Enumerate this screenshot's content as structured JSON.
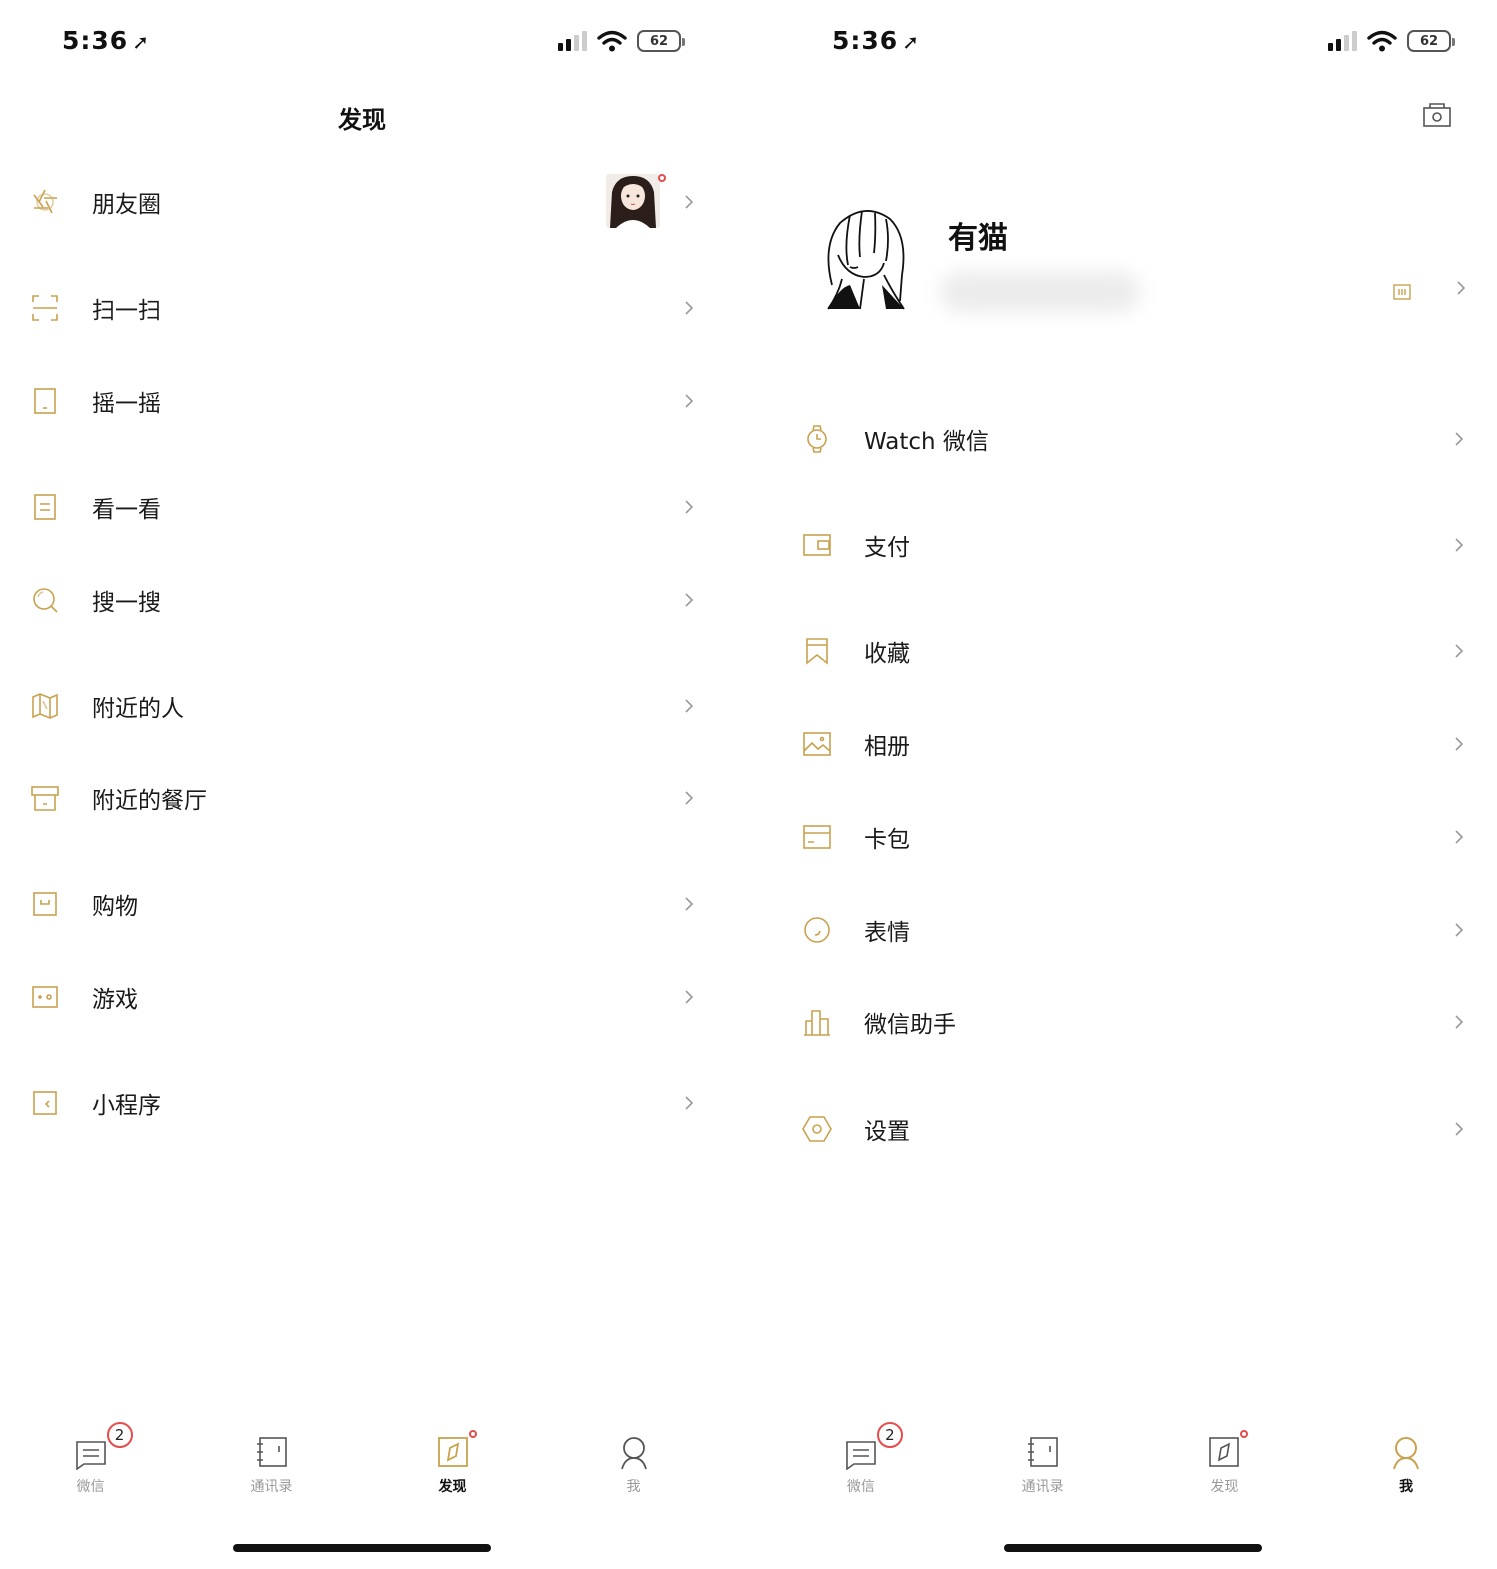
{
  "left": {
    "status": {
      "time": "5:36",
      "battery": "62"
    },
    "title": "发现",
    "items": [
      {
        "label": "朋友圈",
        "icon": "moments-icon"
      },
      {
        "label": "扫一扫",
        "icon": "scan-icon"
      },
      {
        "label": "摇一摇",
        "icon": "shake-icon"
      },
      {
        "label": "看一看",
        "icon": "top-stories-icon"
      },
      {
        "label": "搜一搜",
        "icon": "search-icon"
      },
      {
        "label": "附近的人",
        "icon": "map-icon"
      },
      {
        "label": "附近的餐厅",
        "icon": "restaurant-icon"
      },
      {
        "label": "购物",
        "icon": "shopping-icon"
      },
      {
        "label": "游戏",
        "icon": "game-icon"
      },
      {
        "label": "小程序",
        "icon": "mini-program-icon"
      }
    ],
    "tabs": [
      {
        "label": "微信",
        "badge": "2"
      },
      {
        "label": "通讯录"
      },
      {
        "label": "发现"
      },
      {
        "label": "我"
      }
    ]
  },
  "right": {
    "status": {
      "time": "5:36",
      "battery": "62"
    },
    "profile": {
      "name": "有猫"
    },
    "items": [
      {
        "label": "Watch 微信",
        "icon": "watch-icon"
      },
      {
        "label": "支付",
        "icon": "wallet-icon"
      },
      {
        "label": "收藏",
        "icon": "bookmark-icon"
      },
      {
        "label": "相册",
        "icon": "photo-icon"
      },
      {
        "label": "卡包",
        "icon": "card-icon"
      },
      {
        "label": "表情",
        "icon": "emoji-icon"
      },
      {
        "label": "微信助手",
        "icon": "assistant-icon"
      },
      {
        "label": "设置",
        "icon": "settings-icon"
      }
    ],
    "tabs": [
      {
        "label": "微信",
        "badge": "2"
      },
      {
        "label": "通讯录"
      },
      {
        "label": "发现"
      },
      {
        "label": "我"
      }
    ]
  },
  "colors": {
    "accent": "#c9a24f",
    "badge": "#e64c4c",
    "text": "#1a1a1a",
    "muted": "#9a9a9a"
  }
}
